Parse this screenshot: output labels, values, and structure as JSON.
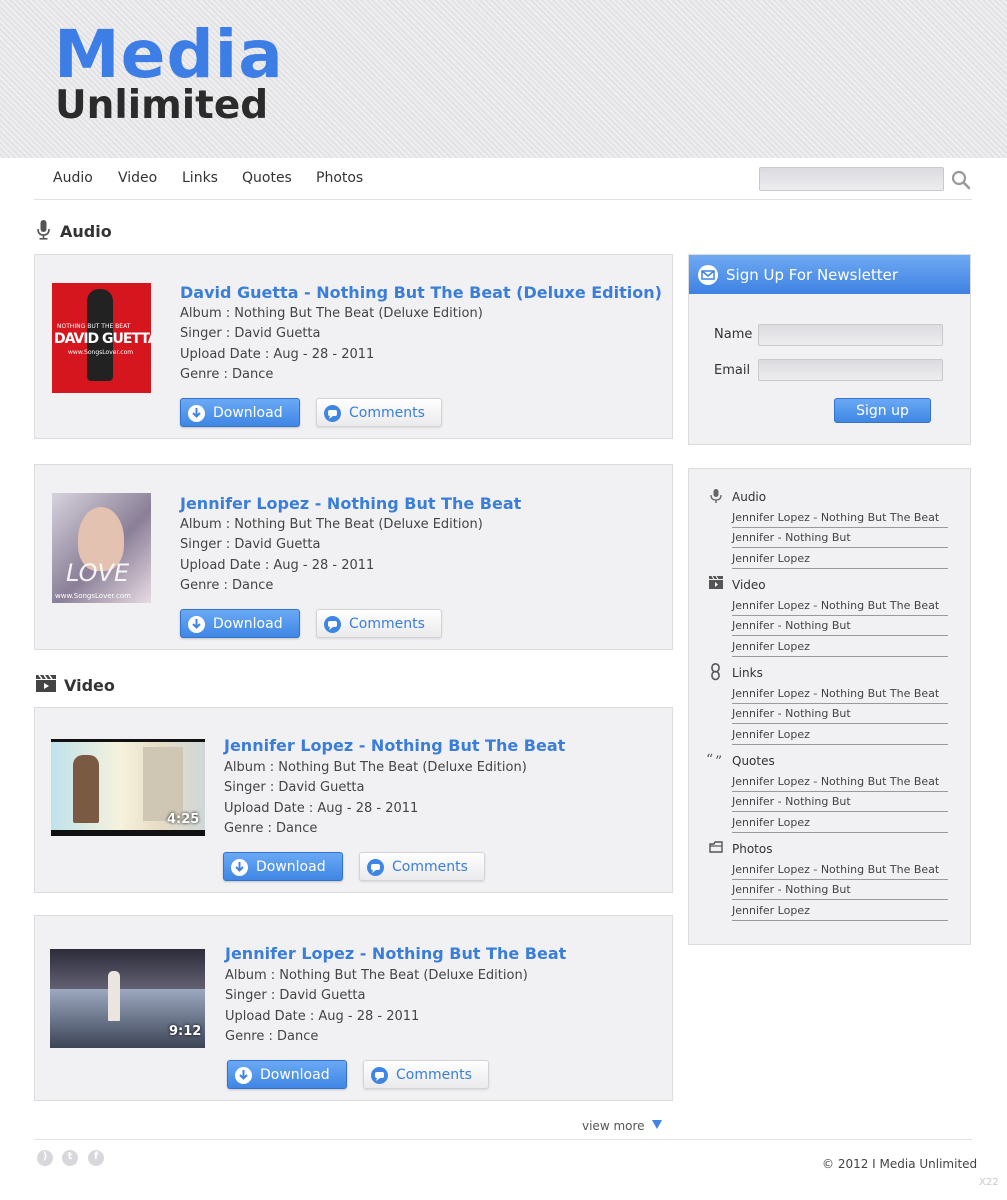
{
  "logo": {
    "line1": "Media",
    "line2": "Unlimited"
  },
  "nav": {
    "items": [
      "Audio",
      "Video",
      "Links",
      "Quotes",
      "Photos"
    ],
    "search_placeholder": ""
  },
  "sections": {
    "audio_title": "Audio",
    "video_title": "Video"
  },
  "buttons": {
    "download": "Download",
    "comments": "Comments"
  },
  "audio_items": [
    {
      "title": "David Guetta - Nothing But The Beat (Deluxe Edition)",
      "album": "Album : Nothing But The Beat (Deluxe Edition)",
      "singer": "Singer : David Guetta",
      "upload": "Upload Date : Aug - 28 - 2011",
      "genre": "Genre : Dance",
      "cover_text": "DAVID GUETTA",
      "cover_small": "NOTHING BUT THE BEAT",
      "cover_url": "www.SongsLover.com"
    },
    {
      "title": "Jennifer Lopez - Nothing But The Beat",
      "album": "Album : Nothing But The Beat (Deluxe Edition)",
      "singer": "Singer : David Guetta",
      "upload": "Upload Date : Aug - 28 - 2011",
      "genre": "Genre : Dance",
      "cover_text": "LOVE",
      "cover_url": "www.SongsLover.com"
    }
  ],
  "video_items": [
    {
      "title": "Jennifer Lopez - Nothing But The Beat",
      "album": "Album : Nothing But The Beat (Deluxe Edition)",
      "singer": "Singer : David Guetta",
      "upload": "Upload Date : Aug - 28 - 2011",
      "genre": "Genre : Dance",
      "duration": "4:25"
    },
    {
      "title": "Jennifer Lopez - Nothing But The Beat",
      "album": "Album : Nothing But The Beat (Deluxe Edition)",
      "singer": "Singer : David Guetta",
      "upload": "Upload Date : Aug - 28 - 2011",
      "genre": "Genre : Dance",
      "duration": "9:12"
    }
  ],
  "newsletter": {
    "title": "Sign Up For Newsletter",
    "name_label": "Name",
    "email_label": "Email",
    "button": "Sign up"
  },
  "sidebar": {
    "categories": [
      {
        "title": "Audio",
        "icon": "microphone-icon",
        "links": [
          "Jennifer Lopez - Nothing But The Beat",
          "Jennifer - Nothing But",
          "Jennifer Lopez"
        ]
      },
      {
        "title": "Video",
        "icon": "clapperboard-icon",
        "links": [
          "Jennifer Lopez - Nothing But The Beat",
          "Jennifer - Nothing But",
          "Jennifer Lopez"
        ]
      },
      {
        "title": "Links",
        "icon": "chain-link-icon",
        "links": [
          "Jennifer Lopez - Nothing But The Beat",
          "Jennifer - Nothing But",
          "Jennifer Lopez"
        ]
      },
      {
        "title": "Quotes",
        "icon": "quote-icon",
        "links": [
          "Jennifer Lopez - Nothing But The Beat",
          "Jennifer - Nothing But",
          "Jennifer Lopez"
        ]
      },
      {
        "title": "Photos",
        "icon": "photo-folder-icon",
        "links": [
          "Jennifer Lopez - Nothing But The Beat",
          "Jennifer - Nothing But",
          "Jennifer Lopez"
        ]
      }
    ]
  },
  "footer": {
    "view_more": "view more",
    "copyright": "© 2012 I Media Unlimited",
    "corner_mark": "X22",
    "social": [
      "rss-icon",
      "twitter-icon",
      "facebook-icon"
    ]
  },
  "colors": {
    "accent": "#3d7ee6",
    "link_blue": "#3a7ed9",
    "card_bg": "#f1f1f3"
  }
}
